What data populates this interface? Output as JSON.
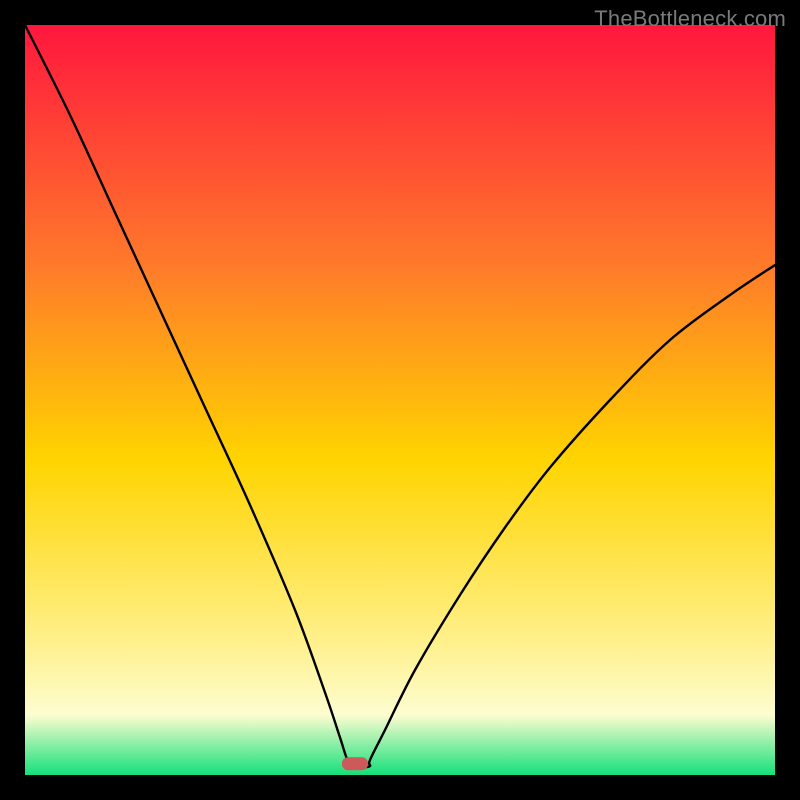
{
  "watermark": "TheBottleneck.com",
  "colors": {
    "frame": "#000000",
    "gradient_top": "#ff173e",
    "gradient_mid_upper": "#ff7a2a",
    "gradient_mid": "#ffd400",
    "gradient_mid_lower": "#fff08a",
    "gradient_low": "#fdfdd0",
    "gradient_bottom": "#14e07a",
    "curve": "#000000",
    "marker": "#cc5a5a"
  },
  "chart_data": {
    "type": "line",
    "title": "",
    "xlabel": "",
    "ylabel": "",
    "xlim": [
      0,
      100
    ],
    "ylim": [
      0,
      100
    ],
    "optimum_x": 44,
    "marker": {
      "x": 44,
      "y": 1.5
    },
    "series": [
      {
        "name": "left-branch",
        "x": [
          0,
          6,
          12,
          18,
          24,
          30,
          36,
          40,
          42,
          43,
          44
        ],
        "y": [
          100,
          88,
          75,
          62,
          49,
          36,
          22,
          11,
          5,
          2,
          1
        ]
      },
      {
        "name": "floor",
        "x": [
          43,
          44,
          45,
          46
        ],
        "y": [
          1.2,
          1.0,
          1.0,
          1.2
        ]
      },
      {
        "name": "right-branch",
        "x": [
          46,
          48,
          52,
          58,
          64,
          70,
          78,
          86,
          94,
          100
        ],
        "y": [
          2,
          6,
          14,
          24,
          33,
          41,
          50,
          58,
          64,
          68
        ]
      }
    ],
    "gradient_stops": [
      {
        "offset": 0.0,
        "key": "gradient_top"
      },
      {
        "offset": 0.32,
        "key": "gradient_mid_upper"
      },
      {
        "offset": 0.58,
        "key": "gradient_mid"
      },
      {
        "offset": 0.82,
        "key": "gradient_mid_lower"
      },
      {
        "offset": 0.92,
        "key": "gradient_low"
      },
      {
        "offset": 1.0,
        "key": "gradient_bottom"
      }
    ]
  }
}
